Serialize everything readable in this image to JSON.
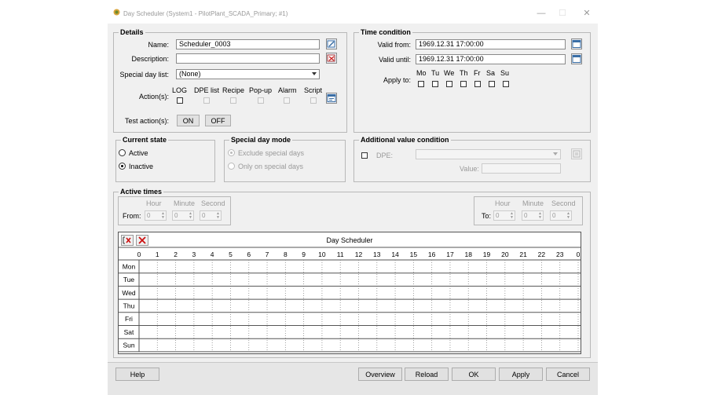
{
  "window": {
    "title": "Day Scheduler (System1 - PilotPlant_SCADA_Primary; #1)",
    "minimize_glyph": "—",
    "maximize_glyph": "☐",
    "close_glyph": "✕"
  },
  "details": {
    "group_label": "Details",
    "name_label": "Name:",
    "name_value": "Scheduler_0003",
    "description_label": "Description:",
    "description_value": "",
    "special_day_list_label": "Special day list:",
    "special_day_list_value": "(None)",
    "actions_label": "Action(s):",
    "actions": [
      {
        "label": "LOG",
        "checked": false,
        "enabled": true
      },
      {
        "label": "DPE list",
        "checked": false,
        "enabled": false
      },
      {
        "label": "Recipe",
        "checked": false,
        "enabled": false
      },
      {
        "label": "Pop-up",
        "checked": false,
        "enabled": false
      },
      {
        "label": "Alarm",
        "checked": false,
        "enabled": false
      },
      {
        "label": "Script",
        "checked": false,
        "enabled": false
      }
    ],
    "test_actions_label": "Test action(s):",
    "on_button": "ON",
    "off_button": "OFF"
  },
  "time_condition": {
    "group_label": "Time condition",
    "valid_from_label": "Valid from:",
    "valid_from_value": "1969.12.31 17:00:00",
    "valid_until_label": "Valid until:",
    "valid_until_value": "1969.12.31 17:00:00",
    "apply_to_label": "Apply to:",
    "days": [
      "Mo",
      "Tu",
      "We",
      "Th",
      "Fr",
      "Sa",
      "Su"
    ]
  },
  "current_state": {
    "group_label": "Current state",
    "active_label": "Active",
    "inactive_label": "Inactive",
    "selected": "Inactive"
  },
  "special_day_mode": {
    "group_label": "Special day mode",
    "exclude_label": "Exclude special days",
    "only_label": "Only on special days",
    "selected": "Exclude special days"
  },
  "additional_value_condition": {
    "group_label": "Additional value condition",
    "dpe_label": "DPE:",
    "value_label": "Value:"
  },
  "active_times": {
    "group_label": "Active times",
    "hour_label": "Hour",
    "minute_label": "Minute",
    "second_label": "Second",
    "from_label": "From:",
    "to_label": "To:",
    "from_values": [
      "0",
      "0",
      "0"
    ],
    "to_values": [
      "0",
      "0",
      "0"
    ]
  },
  "scheduler": {
    "title": "Day Scheduler",
    "hours": [
      "0",
      "1",
      "2",
      "3",
      "4",
      "5",
      "6",
      "7",
      "8",
      "9",
      "10",
      "11",
      "12",
      "13",
      "14",
      "15",
      "16",
      "17",
      "18",
      "19",
      "20",
      "21",
      "22",
      "23",
      "0"
    ],
    "days": [
      "Mon",
      "Tue",
      "Wed",
      "Thu",
      "Fri",
      "Sat",
      "Sun"
    ]
  },
  "buttons": {
    "help": "Help",
    "overview": "Overview",
    "reload": "Reload",
    "ok": "OK",
    "apply": "Apply",
    "cancel": "Cancel"
  },
  "colors": {
    "window_bg": "#f0f0f0",
    "titlebar_bg": "#ffffff",
    "bottom_bar": "#e6e6e6",
    "delete_icon_red": "#cc1111"
  }
}
